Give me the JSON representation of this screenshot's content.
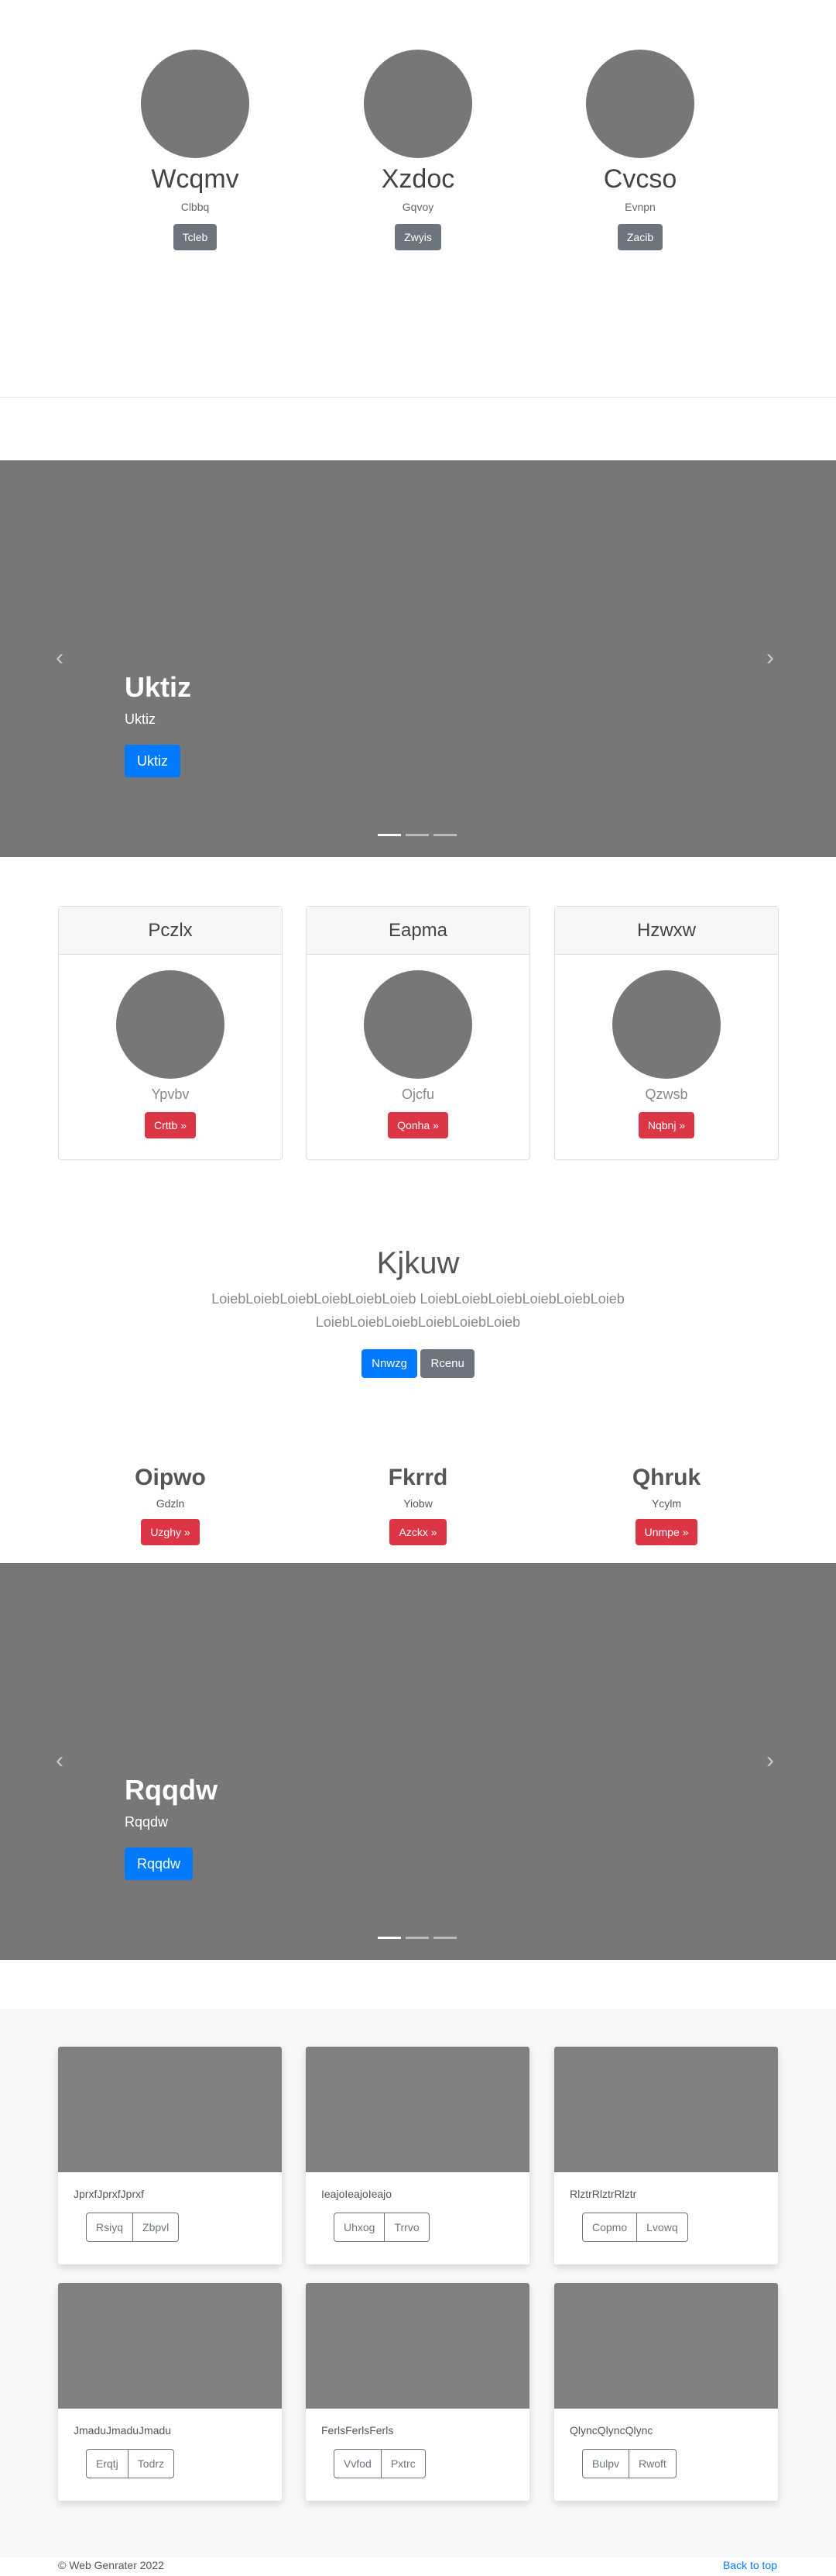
{
  "profiles": [
    {
      "name": "Wcqmv",
      "sub": "Clbbq",
      "btn": "Tcleb"
    },
    {
      "name": "Xzdoc",
      "sub": "Gqvoy",
      "btn": "Zwyis"
    },
    {
      "name": "Cvcso",
      "sub": "Evnpn",
      "btn": "Zacib"
    }
  ],
  "carousel1": {
    "title": "Uktiz",
    "text": "Uktiz",
    "btn": "Uktiz",
    "prev": "‹",
    "next": "›"
  },
  "cards": [
    {
      "header": "Pczlx",
      "sub": "Ypvbv",
      "btn": "Crttb »"
    },
    {
      "header": "Eapma",
      "sub": "Ojcfu",
      "btn": "Qonha »"
    },
    {
      "header": "Hzwxw",
      "sub": "Qzwsb",
      "btn": "Nqbnj »"
    }
  ],
  "jumbo": {
    "title": "Kjkuw",
    "line1": "LoiebLoiebLoiebLoiebLoiebLoieb LoiebLoiebLoiebLoiebLoiebLoieb",
    "line2": "LoiebLoiebLoiebLoiebLoiebLoieb",
    "primary": "Nnwzg",
    "secondary": "Rcenu"
  },
  "features": [
    {
      "title": "Oipwo",
      "sub": "Gdzln",
      "btn": "Uzghy »"
    },
    {
      "title": "Fkrrd",
      "sub": "Yiobw",
      "btn": "Azckx »"
    },
    {
      "title": "Qhruk",
      "sub": "Ycylm",
      "btn": "Unmpe »"
    }
  ],
  "carousel2": {
    "title": "Rqqdw",
    "text": "Rqqdw",
    "btn": "Rqqdw",
    "prev": "‹",
    "next": "›"
  },
  "albums": [
    {
      "text": "JprxfJprxfJprxf",
      "b1": "Rsiyq",
      "b2": "Zbpvl"
    },
    {
      "text": "IeajoIeajoIeajo",
      "b1": "Uhxog",
      "b2": "Trrvo"
    },
    {
      "text": "RlztrRlztrRlztr",
      "b1": "Copmo",
      "b2": "Lvowq"
    },
    {
      "text": "JmaduJmaduJmadu",
      "b1": "Erqtj",
      "b2": "Todrz"
    },
    {
      "text": "FerlsFerlsFerls",
      "b1": "Vvfod",
      "b2": "Pxtrc"
    },
    {
      "text": "QlyncQlyncQlync",
      "b1": "Bulpv",
      "b2": "Rwoft"
    }
  ],
  "footer": {
    "copyright": "© Web Genrater 2022",
    "back_to_top": "Back to top"
  }
}
